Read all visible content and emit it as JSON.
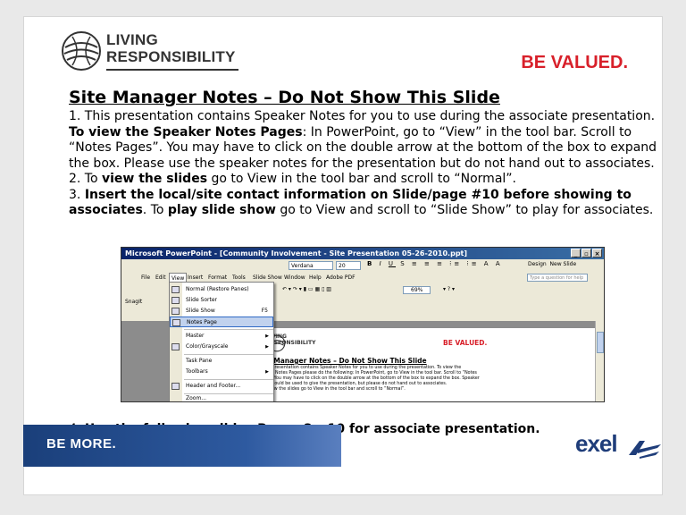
{
  "logo": {
    "line1": "LIVING",
    "line2": "RESPONSIBILITY"
  },
  "tagline": "BE VALUED.",
  "title": "Site Manager Notes – Do Not Show This Slide",
  "item1": {
    "a": "1. This presentation contains Speaker Notes for you to use during the associate presentation. ",
    "b": "To view the Speaker Notes Pages",
    "c": ": In PowerPoint, go to “View” in the tool bar. Scroll to “Notes Pages”. You may have to click on the double arrow at the bottom of the box to expand the box. Please use the speaker notes for the presentation but do not hand out to associates."
  },
  "item2": {
    "a": "2. To ",
    "b": "view the slides",
    "c": " go to View in the tool bar and scroll to “Normal”."
  },
  "item3": {
    "a": "3. ",
    "b": "Insert the local/site contact information on Slide/page #10 before showing to associates",
    "c": ". To ",
    "d": "play slide show",
    "e": " go to View and scroll to “Slide Show” to play for associates."
  },
  "item4": {
    "a": "4. ",
    "b": "Use the following slides Pages 2 – 10 for associate presentation."
  },
  "screenshot": {
    "window_title": "Microsoft PowerPoint - [Community Involvement - Site Presentation 05-26-2010.ppt]",
    "font": "Verdana",
    "size": "20",
    "design": "Design",
    "new_slide": "New Slide",
    "menus": [
      "File",
      "Edit",
      "View",
      "Insert",
      "Format",
      "Tools",
      "Slide Show",
      "Window",
      "Help",
      "Adobe PDF"
    ],
    "help_placeholder": "Type a question for help",
    "zoom": "69%",
    "snagit": "SnagIt",
    "view_menu": [
      {
        "label": "Normal (Restore Panes)",
        "shortcut": ""
      },
      {
        "label": "Slide Sorter",
        "shortcut": ""
      },
      {
        "label": "Slide Show",
        "shortcut": "F5"
      },
      {
        "label": "Notes Page",
        "shortcut": ""
      },
      {
        "label": "Master",
        "shortcut": ""
      },
      {
        "label": "Color/Grayscale",
        "shortcut": ""
      },
      {
        "label": "Task Pane",
        "shortcut": ""
      },
      {
        "label": "Toolbars",
        "shortcut": ""
      },
      {
        "label": "Header and Footer...",
        "shortcut": ""
      },
      {
        "label": "Zoom...",
        "shortcut": ""
      }
    ],
    "notes_logo": {
      "line1": "LIVING",
      "line2": "RESPONSIBILITY"
    },
    "notes_tagline": "BE VALUED.",
    "notes_title": "Site Manager Notes – Do Not Show This Slide",
    "notes_body": [
      "1. This presentation contains Speaker Notes for you to use during the presentation. To view the",
      "Speaker Notes Pages please do the following: In PowerPoint, go to View in the tool bar. Scroll to “Notes",
      "Pages”. You may have to click on the double arrow at the bottom of the box to expand the box. Speaker",
      "notes should be used to give the presentation, but please do not hand out to associates.",
      "2. To view the slides go to View in the tool bar and scroll to “Normal”."
    ]
  },
  "footer": {
    "left": "BE MORE.",
    "brand": "exel"
  }
}
